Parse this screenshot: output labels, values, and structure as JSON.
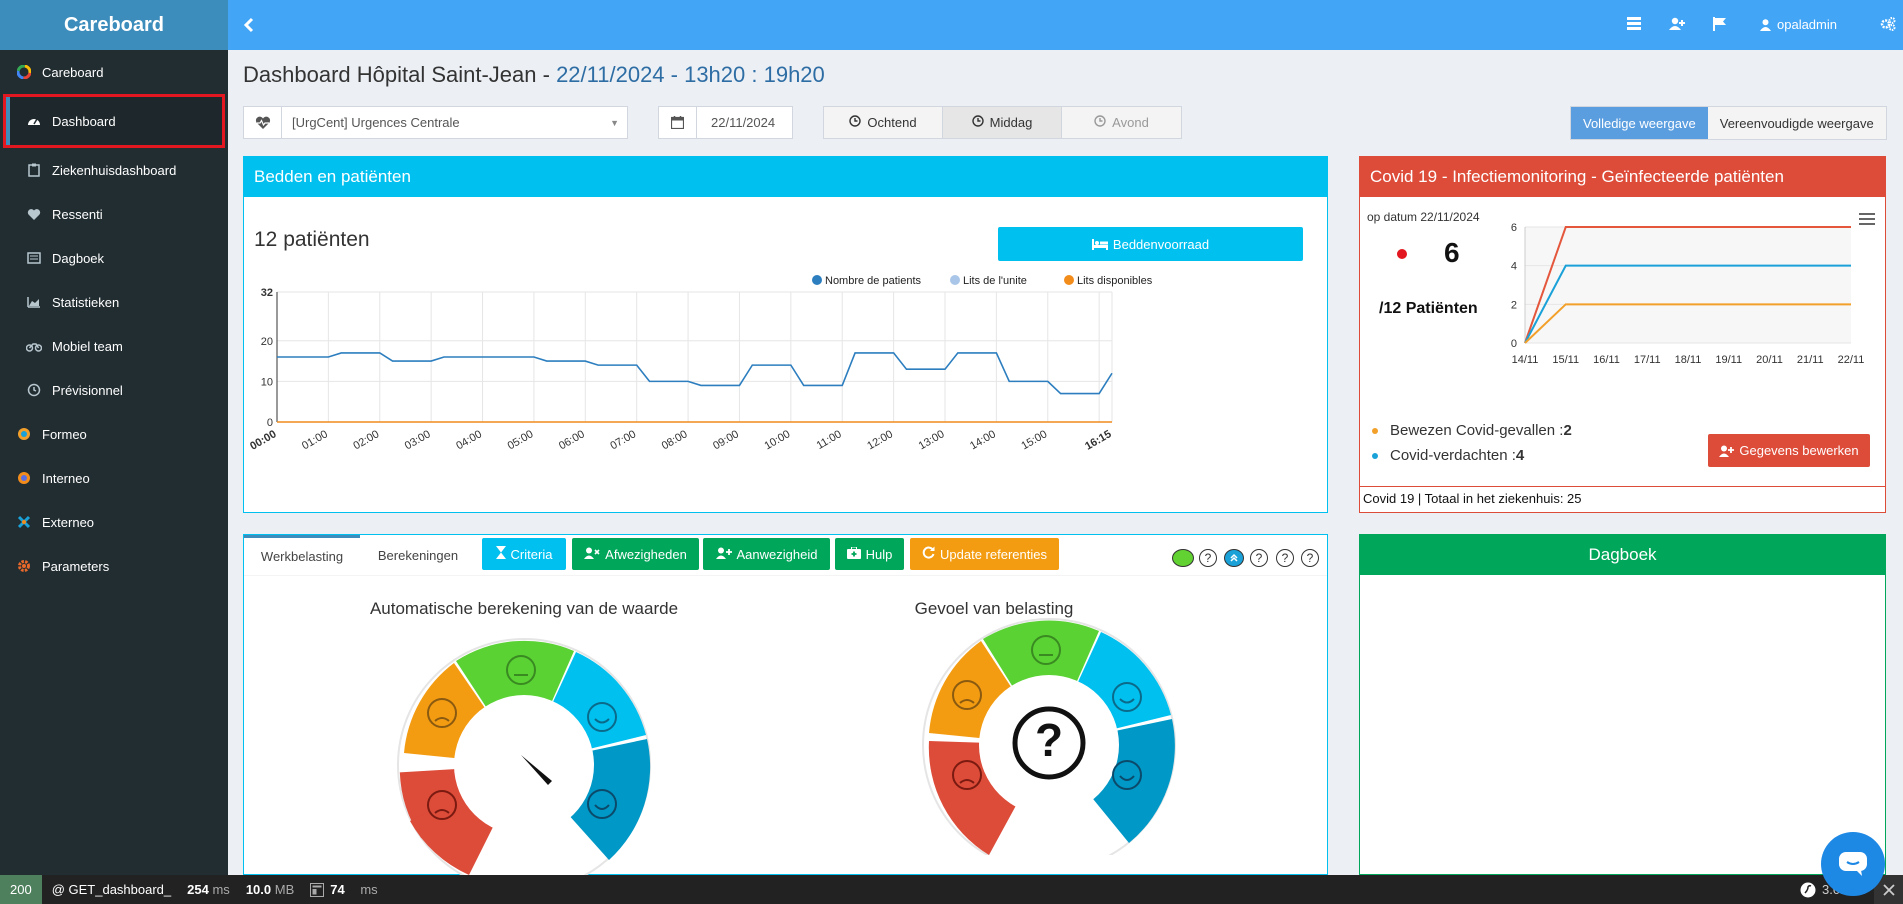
{
  "sidebar": {
    "brand": "Careboard",
    "items": [
      {
        "label": "Careboard",
        "icon": "google-like-icon"
      },
      {
        "label": "Dashboard",
        "icon": "dashboard-icon"
      },
      {
        "label": "Ziekenhuisdashboard",
        "icon": "clipboard-icon"
      },
      {
        "label": "Ressenti",
        "icon": "heart-icon"
      },
      {
        "label": "Dagboek",
        "icon": "book-icon"
      },
      {
        "label": "Statistieken",
        "icon": "area-chart-icon"
      },
      {
        "label": "Mobiel team",
        "icon": "motorcycle-icon"
      },
      {
        "label": "Prévisionnel",
        "icon": "clock-icon"
      },
      {
        "label": "Formeo",
        "icon": "formeo-logo-icon"
      },
      {
        "label": "Interneo",
        "icon": "interneo-logo-icon"
      },
      {
        "label": "Externeo",
        "icon": "externeo-logo-icon"
      },
      {
        "label": "Parameters",
        "icon": "gear-icon"
      }
    ]
  },
  "topbar": {
    "username": "opaladmin"
  },
  "header": {
    "title_main": "Dashboard Hôpital Saint-Jean - ",
    "title_sub": "22/11/2024 - 13h20 : 19h20"
  },
  "filters": {
    "unit_value": "[UrgCent] Urgences Centrale",
    "date_value": "22/11/2024",
    "shifts": [
      "Ochtend",
      "Middag",
      "Avond"
    ],
    "view_full": "Volledige weergave",
    "view_simple": "Vereenvoudigde weergave"
  },
  "beds": {
    "title": "Bedden en patiënten",
    "patients_label": "12 patiënten",
    "stock_button": "Beddenvoorraad"
  },
  "covid": {
    "title": "Covid 19 - Infectiemonitoring - Geïnfecteerde patiënten",
    "date_label": "op datum 22/11/2024",
    "count": "6",
    "of_label": "/12 Patiënten",
    "confirmed_label": "Bewezen Covid-gevallen : ",
    "confirmed_value": "2",
    "suspected_label": "Covid-verdachten : ",
    "suspected_value": "4",
    "edit_button": "Gegevens bewerken",
    "footer": "Covid 19 | Totaal in het ziekenhuis: 25"
  },
  "workload": {
    "tabs": [
      "Werkbelasting",
      "Berekeningen"
    ],
    "buttons": {
      "criteria": "Criteria",
      "absences": "Afwezigheden",
      "presence": "Aanwezigheid",
      "help": "Hulp",
      "update": "Update referenties"
    },
    "gauge1_title": "Automatische berekening van de waarde",
    "gauge2_title": "Gevoel van belasting",
    "gauge2_symbol": "?"
  },
  "diary": {
    "title": "Dagboek"
  },
  "debugbar": {
    "status": "200",
    "route": "@ GET_dashboard_",
    "time_value": "254",
    "time_unit": "ms",
    "memory_value": "10.0",
    "memory_unit": "MB",
    "db_value": "74",
    "db_unit": "ms",
    "version": "3.0.0"
  },
  "chart_data": [
    {
      "type": "line",
      "title": "",
      "legend": [
        "Nombre de patients",
        "Lits de l'unite",
        "Lits disponibles"
      ],
      "legend_position": "top-right",
      "x": [
        "00:00",
        "01:00",
        "02:00",
        "03:00",
        "04:00",
        "05:00",
        "06:00",
        "07:00",
        "08:00",
        "09:00",
        "10:00",
        "11:00",
        "12:00",
        "13:00",
        "14:00",
        "15:00",
        "16:15"
      ],
      "ylim": [
        0,
        32
      ],
      "yticks": [
        0,
        10,
        20,
        32
      ],
      "series": [
        {
          "name": "Nombre de patients",
          "color": "#2c7ebf",
          "points": [
            [
              0,
              16
            ],
            [
              0.5,
              16
            ],
            [
              1,
              16
            ],
            [
              1.25,
              17
            ],
            [
              1.5,
              17
            ],
            [
              2,
              17
            ],
            [
              2.25,
              15
            ],
            [
              2.5,
              15
            ],
            [
              3,
              15
            ],
            [
              3.25,
              16
            ],
            [
              3.5,
              16
            ],
            [
              4,
              16
            ],
            [
              4.5,
              16
            ],
            [
              5,
              16
            ],
            [
              5.25,
              15
            ],
            [
              5.5,
              15
            ],
            [
              6,
              15
            ],
            [
              6.25,
              14
            ],
            [
              6.5,
              14
            ],
            [
              7,
              14
            ],
            [
              7.25,
              10
            ],
            [
              7.5,
              10
            ],
            [
              8,
              10
            ],
            [
              8.25,
              9
            ],
            [
              8.5,
              9
            ],
            [
              9,
              9
            ],
            [
              9.25,
              14
            ],
            [
              9.5,
              14
            ],
            [
              10,
              14
            ],
            [
              10.25,
              9
            ],
            [
              10.5,
              9
            ],
            [
              11,
              9
            ],
            [
              11.25,
              17
            ],
            [
              11.5,
              17
            ],
            [
              12,
              17
            ],
            [
              12.25,
              13
            ],
            [
              12.5,
              13
            ],
            [
              13,
              13
            ],
            [
              13.25,
              17
            ],
            [
              13.5,
              17
            ],
            [
              14,
              17
            ],
            [
              14.25,
              10
            ],
            [
              14.5,
              10
            ],
            [
              15,
              10
            ],
            [
              15.25,
              7
            ],
            [
              15.5,
              7
            ],
            [
              16,
              7
            ],
            [
              16.25,
              12
            ]
          ]
        },
        {
          "name": "Lits de l'unite",
          "color": "#a9c6e8",
          "points": []
        },
        {
          "name": "Lits disponibles",
          "color": "#f28c1b",
          "points": [
            [
              0,
              0
            ],
            [
              16.25,
              0
            ]
          ]
        }
      ]
    },
    {
      "type": "line",
      "title": "",
      "x": [
        "14/11",
        "15/11",
        "16/11",
        "17/11",
        "18/11",
        "19/11",
        "20/11",
        "21/11",
        "22/11"
      ],
      "ylim": [
        0,
        6
      ],
      "yticks": [
        0,
        2,
        4,
        6
      ],
      "series": [
        {
          "name": "",
          "color": "#e4573d",
          "values": [
            0,
            6,
            6,
            6,
            6,
            6,
            6,
            6,
            6
          ]
        },
        {
          "name": "",
          "color": "#1aa1d8",
          "values": [
            0,
            4,
            4,
            4,
            4,
            4,
            4,
            4,
            4
          ]
        },
        {
          "name": "",
          "color": "#f2a02a",
          "values": [
            0,
            2,
            2,
            2,
            2,
            2,
            2,
            2,
            2
          ]
        }
      ]
    }
  ]
}
